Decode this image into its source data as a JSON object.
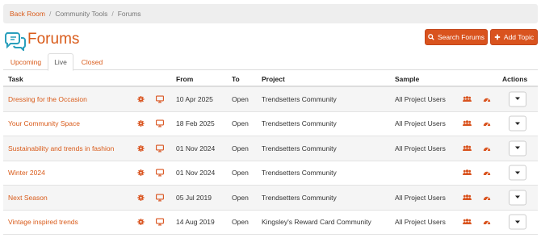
{
  "breadcrumb": {
    "items": [
      "Back Room",
      "Community Tools",
      "Forums"
    ]
  },
  "header": {
    "title": "Forums",
    "search_label": "Search Forums",
    "add_label": "Add Topic"
  },
  "tabs": [
    {
      "label": "Upcoming",
      "active": false
    },
    {
      "label": "Live",
      "active": true
    },
    {
      "label": "Closed",
      "active": false
    }
  ],
  "table": {
    "columns": [
      "Task",
      "From",
      "To",
      "Project",
      "Sample",
      "Actions"
    ],
    "rows": [
      {
        "task": "Dressing for the Occasion",
        "from": "10 Apr 2025",
        "to": "Open",
        "project": "Trendsetters Community",
        "sample": "All Project Users"
      },
      {
        "task": "Your Community Space",
        "from": "18 Feb 2025",
        "to": "Open",
        "project": "Trendsetters Community",
        "sample": "All Project Users"
      },
      {
        "task": "Sustainability and trends in fashion",
        "from": "01 Nov 2024",
        "to": "Open",
        "project": "Trendsetters Community",
        "sample": "All Project Users"
      },
      {
        "task": "Winter 2024",
        "from": "01 Nov 2024",
        "to": "Open",
        "project": "Trendsetters Community",
        "sample": ""
      },
      {
        "task": "Next Season",
        "from": "05 Jul 2019",
        "to": "Open",
        "project": "Trendsetters Community",
        "sample": "All Project Users"
      },
      {
        "task": "Vintage inspired trends",
        "from": "14 Aug 2019",
        "to": "Open",
        "project": "Kingsley's Reward Card Community",
        "sample": "All Project Users"
      }
    ]
  },
  "icons": {
    "title": "forum-chat-icon",
    "search": "search-icon",
    "add": "plus-icon",
    "row_settings": "gear-icon",
    "row_preview": "monitor-icon",
    "row_users": "users-icon",
    "row_dashboard": "dashboard-icon",
    "row_action": "caret-down-icon"
  },
  "colors": {
    "accent": "#d95b1a",
    "button": "#d9531e",
    "title_icon": "#2a9fbc"
  }
}
